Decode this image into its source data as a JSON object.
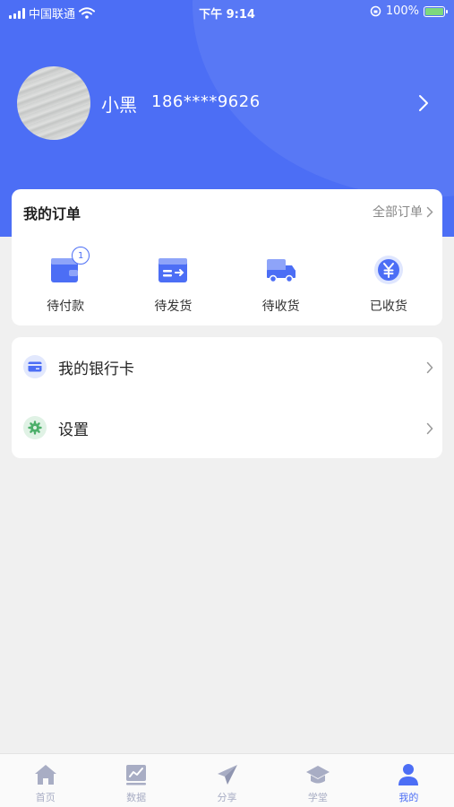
{
  "status_bar": {
    "carrier": "中国联通",
    "time": "下午 9:14",
    "battery": "100%"
  },
  "profile": {
    "name": "小黑",
    "phone": "186****9626"
  },
  "orders": {
    "title": "我的订单",
    "all_label": "全部订单",
    "items": [
      {
        "label": "待付款",
        "icon": "wallet-icon",
        "badge": "1"
      },
      {
        "label": "待发货",
        "icon": "card-send-icon"
      },
      {
        "label": "待收货",
        "icon": "truck-icon"
      },
      {
        "label": "已收货",
        "icon": "yen-coin-icon"
      }
    ]
  },
  "menu": {
    "items": [
      {
        "label": "我的银行卡",
        "icon": "bank-card-icon"
      },
      {
        "label": "设置",
        "icon": "gear-icon"
      }
    ]
  },
  "tabs": [
    {
      "label": "首页",
      "icon": "home-icon"
    },
    {
      "label": "数据",
      "icon": "chart-icon"
    },
    {
      "label": "分享",
      "icon": "send-icon"
    },
    {
      "label": "学堂",
      "icon": "graduation-cap-icon"
    },
    {
      "label": "我的",
      "icon": "user-icon",
      "active": true
    }
  ],
  "colors": {
    "accent": "#4c6ef5",
    "background": "#f0f0f0",
    "tab_inactive": "#a8adc4",
    "settings_icon": "#4caf6a"
  }
}
